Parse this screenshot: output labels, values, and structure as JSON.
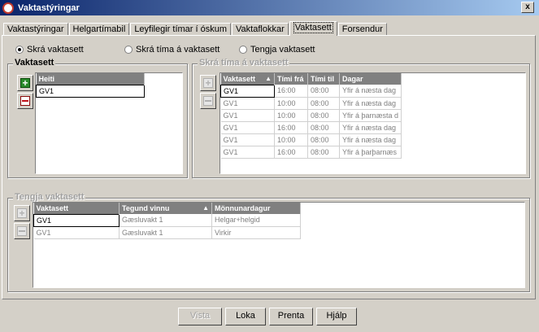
{
  "window": {
    "title": "Vaktastýringar",
    "close_label": "x"
  },
  "tabs": [
    {
      "label": "Vaktastýringar",
      "active": false
    },
    {
      "label": "Helgartímabil",
      "active": false
    },
    {
      "label": "Leyfilegir tímar í óskum",
      "active": false
    },
    {
      "label": "Vaktaflokkar",
      "active": false
    },
    {
      "label": "Vaktasett",
      "active": true
    },
    {
      "label": "Forsendur",
      "active": false
    }
  ],
  "modes": [
    {
      "label": "Skrá vaktasett",
      "checked": true
    },
    {
      "label": "Skrá tíma á vaktasett",
      "checked": false
    },
    {
      "label": "Tengja vaktasett",
      "checked": false
    }
  ],
  "vaktasett_group": {
    "legend": "Vaktasett",
    "columns": [
      "Heiti"
    ],
    "rows": [
      [
        "GV1"
      ]
    ]
  },
  "times_group": {
    "legend": "Skrá tíma á vaktasett",
    "columns": [
      "Vaktasett",
      "Tími frá",
      "Tími til",
      "Dagar"
    ],
    "rows": [
      [
        "GV1",
        "16:00",
        "08:00",
        "Yfir á næsta dag"
      ],
      [
        "GV1",
        "10:00",
        "08:00",
        "Yfir á næsta dag"
      ],
      [
        "GV1",
        "10:00",
        "08:00",
        "Yfir á þarnæsta d"
      ],
      [
        "GV1",
        "16:00",
        "08:00",
        "Yfir á næsta dag"
      ],
      [
        "GV1",
        "10:00",
        "08:00",
        "Yfir á næsta dag"
      ],
      [
        "GV1",
        "16:00",
        "08:00",
        "Yfir á þarþarnæs"
      ]
    ]
  },
  "link_group": {
    "legend": "Tengja vaktasett",
    "columns": [
      "Vaktasett",
      "Tegund vinnu",
      "Mönnunardagur"
    ],
    "rows": [
      [
        "GV1",
        "Gæsluvakt 1",
        "Helgar+helgid"
      ],
      [
        "GV1",
        "Gæsluvakt 1",
        "Virkir"
      ]
    ]
  },
  "buttons": {
    "save": "Vista",
    "close": "Loka",
    "print": "Prenta",
    "help": "Hjálp"
  }
}
